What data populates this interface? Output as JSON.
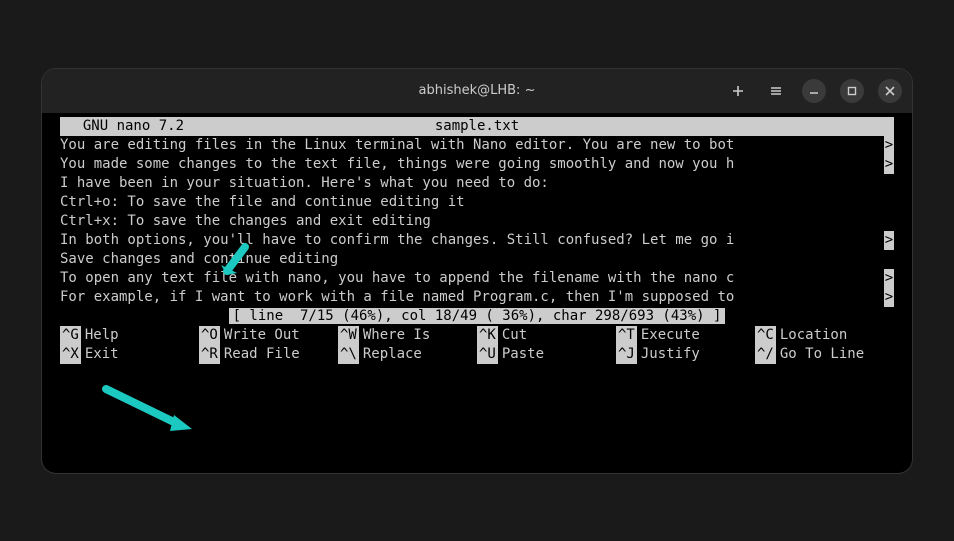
{
  "titlebar": {
    "title": "abhishek@LHB: ~"
  },
  "nano": {
    "version_label": "  GNU nano 7.2",
    "filename": "sample.txt"
  },
  "body_lines": [
    {
      "text": "You are editing files in the Linux terminal with Nano editor. You are new to bot",
      "truncated": true
    },
    {
      "text": "",
      "truncated": false
    },
    {
      "text": "You made some changes to the text file, things were going smoothly and now you h",
      "truncated": true
    },
    {
      "text": "",
      "truncated": false
    },
    {
      "text": "I have been in your situation. Here's what you need to do:",
      "truncated": false
    },
    {
      "text": "",
      "truncated": false
    },
    {
      "text": "Ctrl+o: To save the file and continue editing it",
      "truncated": false
    },
    {
      "text": "Ctrl+x: To save the changes and exit editing",
      "truncated": false
    },
    {
      "text": "In both options, you'll have to confirm the changes. Still confused? Let me go i",
      "truncated": true
    },
    {
      "text": "",
      "truncated": false
    },
    {
      "text": "Save changes and continue editing",
      "truncated": false
    },
    {
      "text": "To open any text file with nano, you have to append the filename with the nano c",
      "truncated": true
    },
    {
      "text": "",
      "truncated": false
    },
    {
      "text": "For example, if I want to work with a file named Program.c, then I'm supposed to",
      "truncated": true
    }
  ],
  "status": "[ line  7/15 (46%), col 18/49 ( 36%), char 298/693 (43%) ]",
  "shortcuts_row1": [
    {
      "key": "^G",
      "label": "Help"
    },
    {
      "key": "^O",
      "label": "Write Out"
    },
    {
      "key": "^W",
      "label": "Where Is"
    },
    {
      "key": "^K",
      "label": "Cut"
    },
    {
      "key": "^T",
      "label": "Execute"
    },
    {
      "key": "^C",
      "label": "Location"
    }
  ],
  "shortcuts_row2": [
    {
      "key": "^X",
      "label": "Exit"
    },
    {
      "key": "^R",
      "label": "Read File"
    },
    {
      "key": "^\\",
      "label": "Replace"
    },
    {
      "key": "^U",
      "label": "Paste"
    },
    {
      "key": "^J",
      "label": "Justify"
    },
    {
      "key": "^/",
      "label": "Go To Line"
    }
  ]
}
